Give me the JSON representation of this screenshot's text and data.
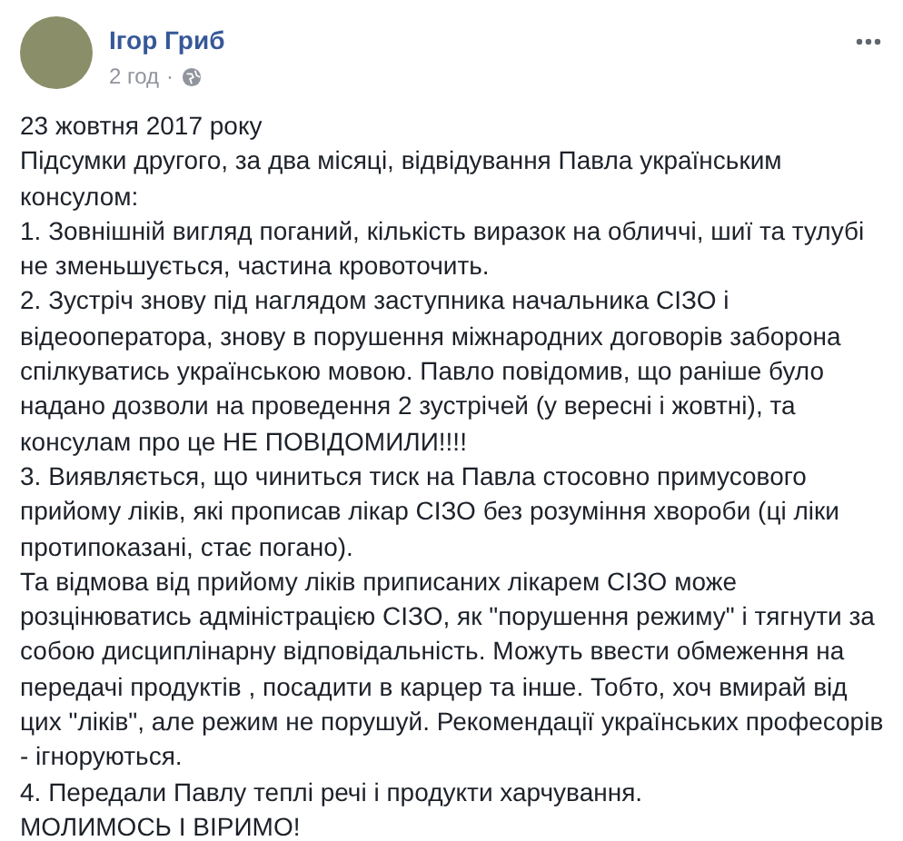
{
  "post": {
    "author": "Ігор Гриб",
    "time": "2 год",
    "separator": "·",
    "paragraphs": [
      "23 жовтня 2017 року",
      "Підсумки другого, за два місяці, відвідування Павла українським консулом:",
      "1. Зовнішній вигляд поганий, кількість виразок на обличчі, шиї та тулубі не зменьшується, частина кровоточить.",
      "2. Зустріч знову під наглядом заступника начальника СІЗО і відеооператора, знову в порушення міжнародних договорів заборона спілкуватись українською мовою. Павло повідомив, що раніше було надано дозволи на проведення 2 зустрічей (у вересні і жовтні), та консулам про це НЕ ПОВІДОМИЛИ!!!!",
      "3. Виявляється, що чиниться тиск на Павла стосовно примусового прийому ліків, які прописав лікар СІЗО без розуміння хвороби (ці ліки протипоказані, стає погано).",
      "Та відмова від прийому ліків приписаних лікарем СІЗО може розцінюватись адміністрацією СІЗО, як \"порушення режиму\" і тягнути за собою дисциплінарну відповідальність. Можуть ввести обмеження на передачі продуктів , посадити в карцер та інше. Тобто, хоч вмирай від цих \"ліків\", але режим не порушуй. Рекомендації українських професорів - ігноруються.",
      "4. Передали Павлу теплі речі і продукти харчування.",
      "МОЛИМОСЬ І ВІРИМО!"
    ]
  }
}
